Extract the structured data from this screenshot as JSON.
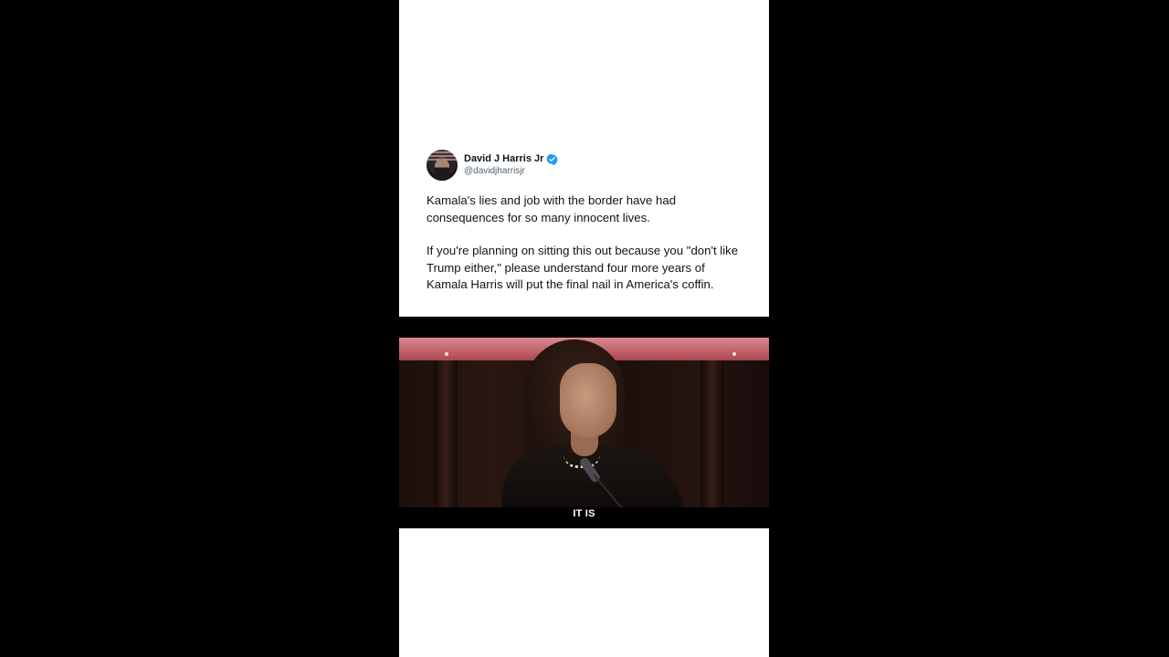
{
  "tweet": {
    "author_name": "David J Harris Jr",
    "handle": "@davidjharrisjr",
    "paragraphs": [
      "Kamala's lies and job with the border have had consequences for so many innocent lives.",
      "If you're planning on sitting this out because you \"don't like Trump either,\" please understand four more years of Kamala Harris will put the final nail in America's coffin."
    ]
  },
  "video": {
    "caption": "IT IS"
  },
  "colors": {
    "background": "#000000",
    "panel": "#ffffff",
    "text": "#0f1419",
    "handle": "#536471",
    "verified": "#1d9bf0"
  }
}
